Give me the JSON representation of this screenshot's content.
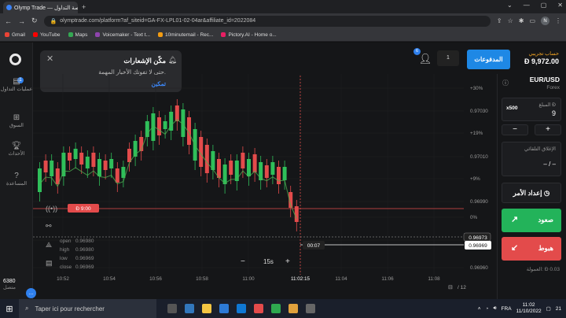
{
  "browser": {
    "tab_title": "Olymp Trade — منصة التداول",
    "url": "olymptrade.com/platform?af_siteid=GA-FX-LPL01-02-04ar&affiliate_id=2022084",
    "bookmarks": [
      {
        "label": "Gmail",
        "color": "#ea4335"
      },
      {
        "label": "YouTube",
        "color": "#ff0000"
      },
      {
        "label": "Maps",
        "color": "#34a853"
      },
      {
        "label": "Voicemaker - Text t...",
        "color": "#8e44ad"
      },
      {
        "label": "10minutemail - Rec...",
        "color": "#f39c12"
      },
      {
        "label": "Pictory.AI - Home o...",
        "color": "#e91e63"
      }
    ]
  },
  "nav": {
    "trades": "عمليات التداول",
    "trades_badge": "1",
    "market": "السوق",
    "events": "الأحداث",
    "help": "المساعدة",
    "bottom_value": "6380",
    "bottom_sub": "متصل"
  },
  "notification": {
    "title": "مكّن الإشعارات",
    "text": "حتى لا تفوتك الأخبار المهمة.",
    "action": "تمكين"
  },
  "header": {
    "account_type": "حساب تجريبي",
    "balance": "Đ 9,972.00",
    "payments": "المدفوعات",
    "tab": "1",
    "user_badge": "6"
  },
  "chart_data": {
    "type": "candlestick",
    "asset": "EUR/USD",
    "y_ticks": [
      "+30%",
      "0.97030",
      "+19%",
      "0.97010",
      "+9%",
      "0.96990",
      "0%",
      "0.96970",
      "0.96960"
    ],
    "x_ticks": [
      "10:52",
      "10:54",
      "10:56",
      "10:58",
      "11:00",
      "11:02:15",
      "11:04",
      "11:06",
      "11:08"
    ],
    "price_tag": "0.96973",
    "current_price": "0.96969",
    "countdown": "00:07",
    "open_label": "open",
    "open": "0.96980",
    "high_label": "high",
    "high": "0.96980",
    "low_label": "low",
    "low": "0.96969",
    "close_label": "close",
    "close": "0.96969",
    "trade_marker": "Đ 9:00",
    "timeframe": "15s",
    "zoom_minus": "−",
    "zoom_plus": "+",
    "page": "/ 12"
  },
  "panel": {
    "pair": "EUR/USD",
    "market": "Forex",
    "amount_label": "المبلغ Đ",
    "amount": "9",
    "multiplier": "x500",
    "minus": "−",
    "plus": "+",
    "autoclose_label": "الإغلاق التلقائي",
    "autoclose_value": "– / –",
    "order": "إعداد الأمر",
    "up": "صعود",
    "down": "هبوط",
    "commission": "العمولة: Đ 0.03"
  },
  "taskbar": {
    "search": "Taper ici pour rechercher",
    "lang": "FRA",
    "time": "11:02",
    "date": "11/10/2022",
    "notif": "21"
  }
}
